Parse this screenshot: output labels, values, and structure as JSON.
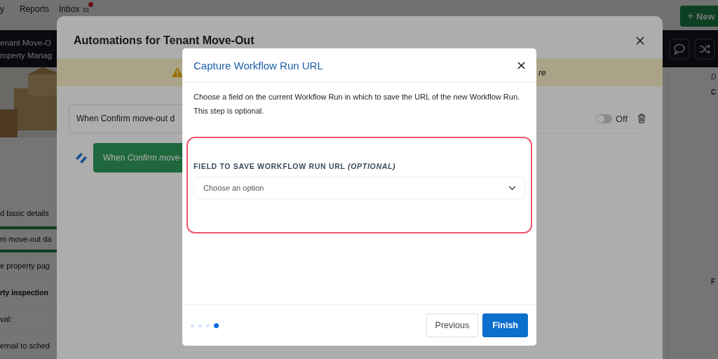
{
  "app": {
    "nav": [
      {
        "label": "y"
      },
      {
        "label": "Reports"
      },
      {
        "label": "Inbox",
        "count": "31",
        "unread": true
      }
    ],
    "new_button": {
      "icon": "+",
      "label": "New"
    },
    "header": {
      "title": "enant Move-O",
      "subtitle": "roperty Manag"
    },
    "steps": [
      {
        "label": "d basic details",
        "bold": false,
        "selected": false
      },
      {
        "label": "m move-out da",
        "bold": false,
        "selected": true
      },
      {
        "label": "e property pag",
        "bold": false,
        "selected": false
      },
      {
        "label": "rty inspection",
        "bold": true,
        "selected": false
      },
      {
        "label": "val:",
        "bold": false,
        "selected": false
      },
      {
        "label": "email to sched",
        "bold": false,
        "selected": false
      }
    ],
    "right_panel": {
      "labels": [
        "D",
        "C",
        "F"
      ]
    }
  },
  "automations_modal": {
    "title": "Automations for Tenant Move-Out",
    "banner": {
      "text": "re"
    },
    "automation": {
      "trigger_text": "When Confirm move-out d",
      "toggle": {
        "on": false,
        "label": "Off"
      }
    },
    "trigger_button": {
      "text": "When *Confirm move-*"
    }
  },
  "capture_modal": {
    "title": "Capture Workflow Run URL",
    "description": "Choose a field on the current Workflow Run in which to save the URL of the new Workflow Run. This step is optional.",
    "field": {
      "label": "FIELD TO SAVE WORKFLOW RUN URL *(OPTIONAL)*",
      "placeholder": "Choose an option"
    },
    "steps": [
      {
        "selected": false
      },
      {
        "selected": false
      },
      {
        "selected": false
      },
      {
        "selected": true
      }
    ],
    "buttons": [
      {
        "label": "Previous",
        "kind": "secondary"
      },
      {
        "label": "Finish",
        "kind": "primary"
      }
    ]
  }
}
